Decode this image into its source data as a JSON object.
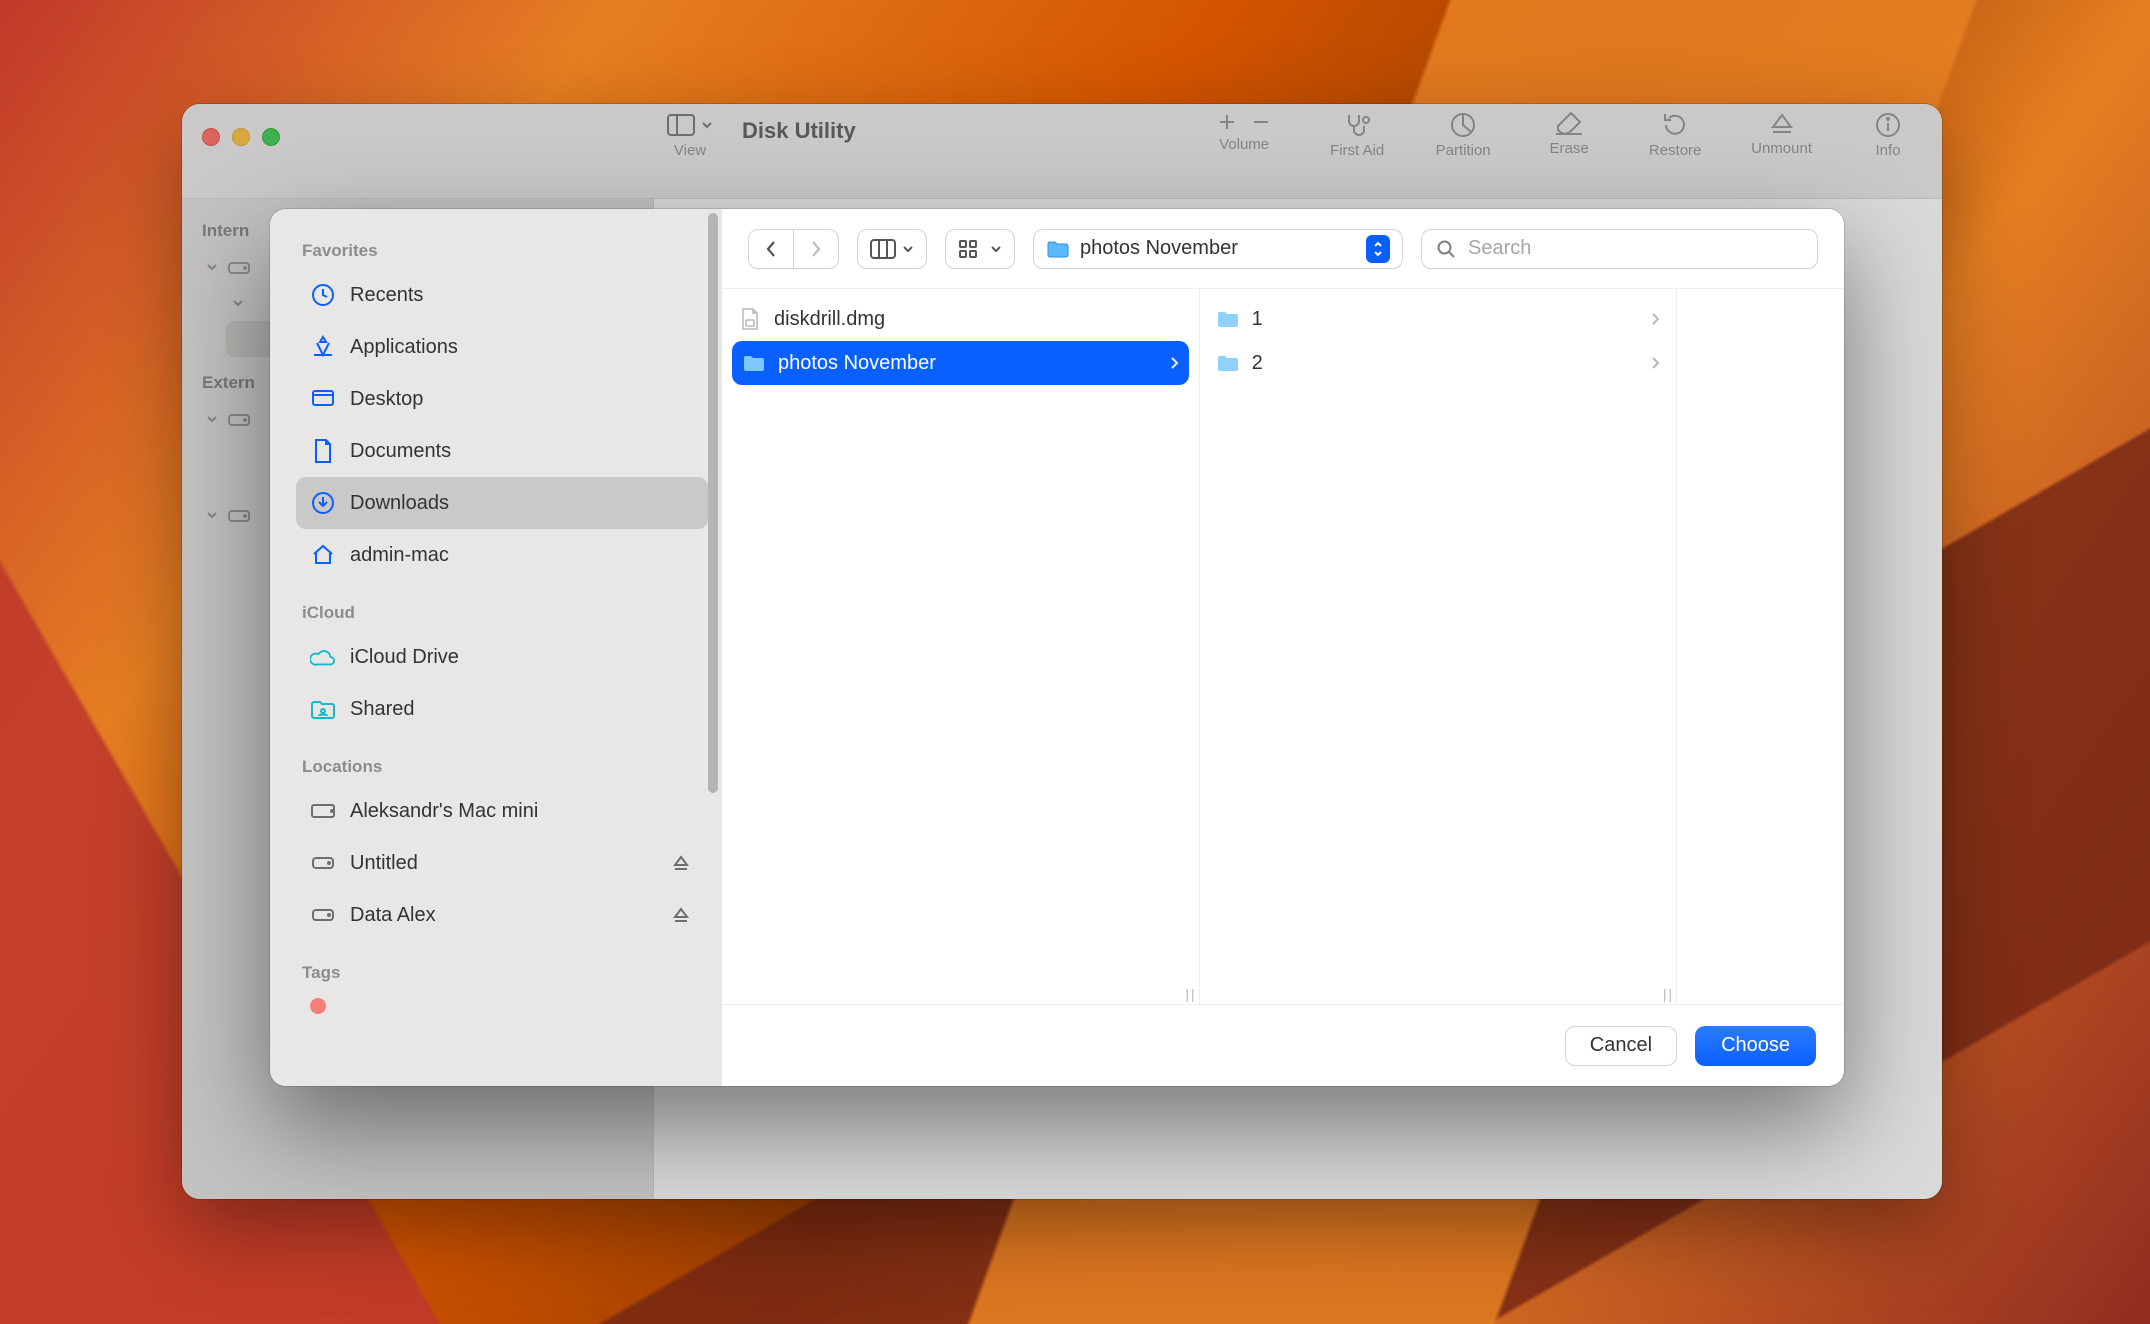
{
  "disk_utility": {
    "title": "Disk Utility",
    "toolbar": {
      "view_label": "View",
      "actions": {
        "volume": "Volume",
        "first_aid": "First Aid",
        "partition": "Partition",
        "erase": "Erase",
        "restore": "Restore",
        "unmount": "Unmount",
        "info": "Info"
      }
    },
    "sidebar": {
      "section1": "Intern",
      "section2": "Extern"
    }
  },
  "sheet": {
    "sidebar": {
      "favorites_heading": "Favorites",
      "favorites": [
        {
          "label": "Recents",
          "icon": "clock"
        },
        {
          "label": "Applications",
          "icon": "apps"
        },
        {
          "label": "Desktop",
          "icon": "desktop"
        },
        {
          "label": "Documents",
          "icon": "document"
        },
        {
          "label": "Downloads",
          "icon": "download",
          "selected": true
        },
        {
          "label": "admin-mac",
          "icon": "home"
        }
      ],
      "icloud_heading": "iCloud",
      "icloud": [
        {
          "label": "iCloud Drive",
          "icon": "cloud"
        },
        {
          "label": "Shared",
          "icon": "shared"
        }
      ],
      "locations_heading": "Locations",
      "locations": [
        {
          "label": "Aleksandr's Mac mini",
          "icon": "computer"
        },
        {
          "label": "Untitled",
          "icon": "disk",
          "eject": true
        },
        {
          "label": "Data Alex",
          "icon": "disk",
          "eject": true
        }
      ],
      "tags_heading": "Tags"
    },
    "toolbar": {
      "path_label": "photos November",
      "search_placeholder": "Search"
    },
    "columns": [
      {
        "items": [
          {
            "label": "diskdrill.dmg",
            "type": "file"
          },
          {
            "label": "photos November",
            "type": "folder",
            "selected": true
          }
        ]
      },
      {
        "items": [
          {
            "label": "1",
            "type": "folder"
          },
          {
            "label": "2",
            "type": "folder"
          }
        ]
      },
      {
        "items": []
      }
    ],
    "footer": {
      "cancel": "Cancel",
      "choose": "Choose"
    }
  }
}
